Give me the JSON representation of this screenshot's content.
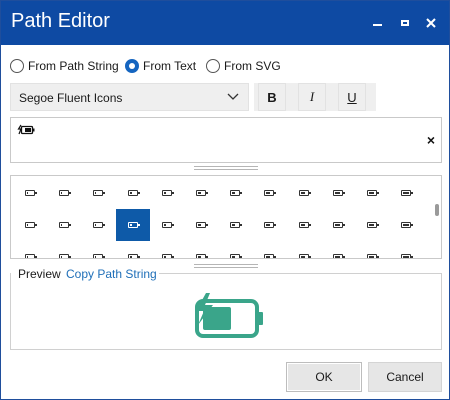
{
  "window": {
    "title": "Path Editor"
  },
  "source_options": [
    {
      "label": "From Path String",
      "selected": false
    },
    {
      "label": "From Text",
      "selected": true
    },
    {
      "label": "From SVG",
      "selected": false
    }
  ],
  "font": {
    "family": "Segoe Fluent Icons",
    "bold_label": "B",
    "italic_label": "I",
    "underline_label": "U"
  },
  "text_input": {
    "value": "",
    "clear_label": "×"
  },
  "icon_grid": {
    "selected_row": 1,
    "selected_col": 3,
    "rows": [
      [
        "battery-0",
        "battery-1",
        "battery-2",
        "battery-3",
        "battery-4",
        "battery-5",
        "battery-6",
        "battery-7",
        "battery-8",
        "battery-9",
        "battery-10",
        "battery-11"
      ],
      [
        "battery-charging-0",
        "battery-charging-1",
        "battery-charging-2",
        "battery-charging-3",
        "battery-charging-4",
        "battery-charging-5",
        "battery-charging-6",
        "battery-charging-7",
        "battery-charging-8",
        "battery-charging-9",
        "battery-charging-10",
        "battery-charging-11"
      ],
      [
        "battery-saver-0",
        "battery-saver-1",
        "battery-saver-2",
        "battery-saver-3",
        "battery-saver-4",
        "battery-saver-5",
        "battery-saver-6",
        "battery-saver-7",
        "battery-saver-8",
        "battery-saver-9",
        "battery-saver-10",
        "battery-saver-11"
      ]
    ]
  },
  "preview": {
    "label": "Preview",
    "copy_link": "Copy Path String",
    "icon": "battery-charging-icon",
    "icon_color": "#3aa58a"
  },
  "buttons": {
    "ok": "OK",
    "cancel": "Cancel"
  },
  "colors": {
    "titlebar": "#0e4aa3",
    "accent": "#1565c0",
    "selection": "#0e5aa8",
    "link": "#1f6fb8"
  }
}
